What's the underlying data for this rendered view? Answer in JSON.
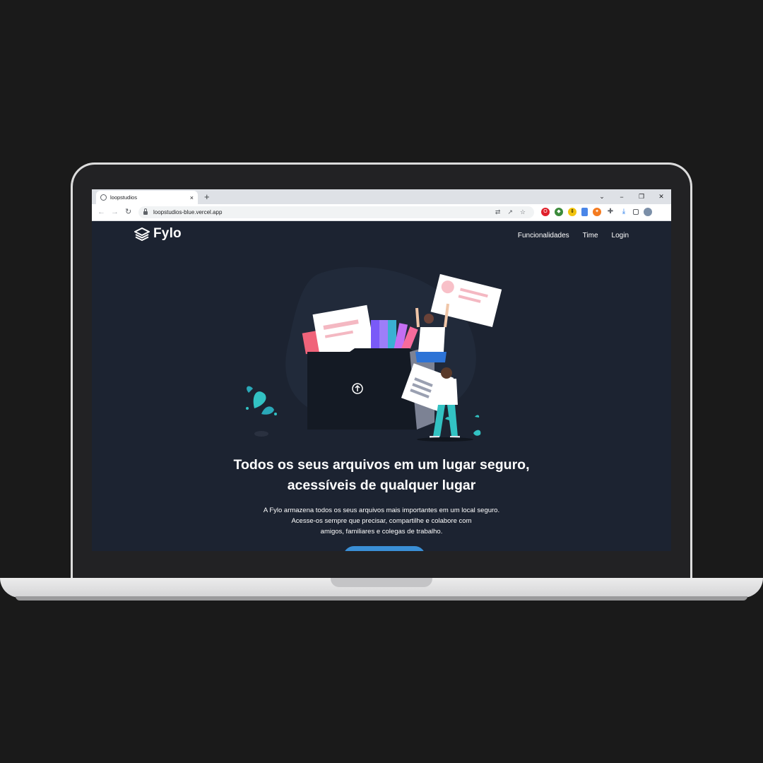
{
  "browser": {
    "tab_title": "loopstudios",
    "tab_close": "×",
    "new_tab": "+",
    "window_controls": [
      "⌄",
      "−",
      "❐",
      "✕"
    ],
    "back": "←",
    "forward": "→",
    "reload": "↻",
    "url": "loopstudios-blue.vercel.app",
    "omnibox_icons": [
      "translate-icon",
      "share-icon",
      "star-icon"
    ],
    "extensions": [
      "opera-icon",
      "shield-icon",
      "arrows-icon",
      "doc-icon",
      "puzzle-badge-icon",
      "extensions-icon",
      "download-icon",
      "sidebar-icon",
      "profile-avatar"
    ]
  },
  "site": {
    "logo_text": "Fylo",
    "nav": [
      "Funcionalidades",
      "Time",
      "Login"
    ],
    "hero": {
      "title_line1": "Todos os seus arquivos em um lugar seguro,",
      "title_line2": "acessíveis de qualquer lugar",
      "text_line1": "A Fylo armazena todos os seus arquivos mais importantes em um local seguro.",
      "text_line2": "Acesse-os sempre que precisar, compartilhe e colabore com",
      "text_line3": "amigos, familiares e colegas de trabalho."
    }
  },
  "colors": {
    "page_bg": "#1c2331",
    "accent": "#3a8fd6",
    "outer_bg": "#1a1a1a"
  }
}
